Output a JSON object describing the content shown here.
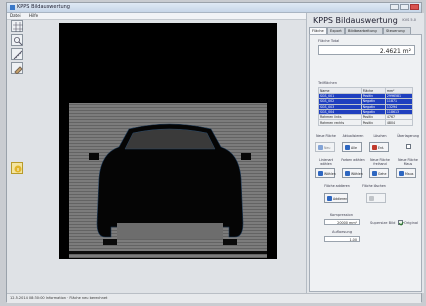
{
  "window": {
    "title": "KPPS Bildauswertung"
  },
  "menu": {
    "items": [
      "Datei",
      "Hilfe"
    ]
  },
  "toolbar": {
    "icons": [
      "grid-icon",
      "zoom-icon",
      "measure-icon",
      "pick-icon",
      "info-icon"
    ]
  },
  "panel": {
    "title": "KPPS Bildauswertung",
    "version": "KVS 5.0",
    "tabs": [
      "Fläche",
      "Export",
      "Bildbearbeitung",
      "Steuerung"
    ],
    "flaeche_total_label": "Fläche Total",
    "flaeche_total_value": "2.4621 m²",
    "teilflaechen_label": "Teilflächen",
    "table": {
      "headers": [
        "Name",
        "Fläche",
        "mm²"
      ],
      "rows": [
        [
          "SGS_001",
          "Positiv",
          "2996581"
        ],
        [
          "SGS_002",
          "Negativ",
          "11871"
        ],
        [
          "SGS_003",
          "Negativ",
          "13294"
        ],
        [
          "SGS_004",
          "Negativ",
          "118613"
        ],
        [
          "Rahmen links",
          "Positiv",
          "4767"
        ],
        [
          "Rahmen rechts",
          "Positiv",
          "4804"
        ]
      ]
    },
    "group1": [
      {
        "label": "Neue Fläche",
        "btn": "Neu"
      },
      {
        "label": "Aktualisieren",
        "btn": "Alle"
      },
      {
        "label": "Löschen",
        "btn": "Ent."
      },
      {
        "label": "Überlagerung",
        "btn": ""
      }
    ],
    "group2": [
      {
        "label": "Linienart wählen",
        "btn": "Wählen"
      },
      {
        "label": "Farben wählen",
        "btn": "Wählen"
      },
      {
        "label": "Neue Fläche freihand",
        "btn": "Gehe"
      },
      {
        "label": "Neue Fläche Maus",
        "btn": "Maus"
      }
    ],
    "group3": [
      {
        "label": "Fläche addieren",
        "btn": "Addieren"
      },
      {
        "label": "Fläche löschen",
        "btn": ""
      }
    ],
    "kompression_label": "Kompression",
    "kompression_value": "20000 mm²",
    "aufloesung_label": "Aufloesung",
    "aufloesung_value": "1.00",
    "supersize_label": "Supersize Bild",
    "supersize_value": "Original"
  },
  "status": {
    "text": "12.5.2014 08:30:00 Information · Fläche neu berechnet"
  }
}
